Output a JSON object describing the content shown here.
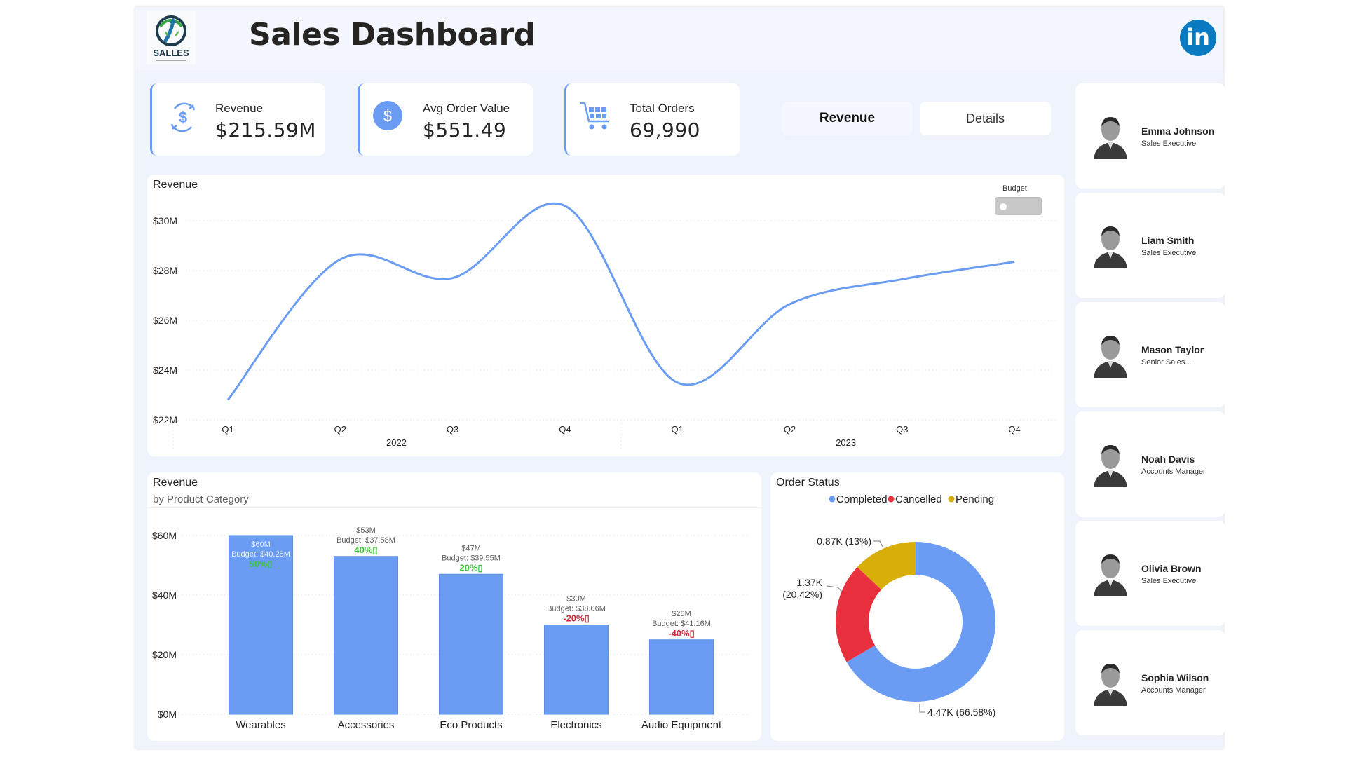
{
  "header": {
    "logo_text": "SALLES",
    "title": "Sales Dashboard",
    "linkedin_label": "in"
  },
  "kpis": [
    {
      "label": "Revenue",
      "value": "$215.59M",
      "icon": "revenue-cycle-icon"
    },
    {
      "label": "Avg Order Value",
      "value": "$551.49",
      "icon": "dollar-circle-icon"
    },
    {
      "label": "Total Orders",
      "value": "69,990",
      "icon": "shopping-cart-icon"
    }
  ],
  "tabs": {
    "revenue": "Revenue",
    "details": "Details"
  },
  "budget_toggle": {
    "label": "Budget",
    "on": false
  },
  "colors": {
    "accent": "#6a9cf4",
    "completed": "#6a9cf4",
    "cancelled": "#e8303f",
    "pending": "#d8ae08",
    "positive": "#3fc43a",
    "negative": "#d4293a",
    "linkedin": "#0a7bc1"
  },
  "chart_data": [
    {
      "type": "line",
      "title": "Revenue",
      "x": [
        "Q1",
        "Q2",
        "Q3",
        "Q4",
        "Q1",
        "Q2",
        "Q3",
        "Q4"
      ],
      "x_groups": [
        {
          "label": "2022",
          "span": [
            0,
            3
          ]
        },
        {
          "label": "2023",
          "span": [
            4,
            7
          ]
        }
      ],
      "series": [
        {
          "name": "Revenue",
          "values": [
            22.8,
            28.45,
            27.7,
            30.6,
            23.5,
            26.65,
            27.65,
            28.35
          ]
        }
      ],
      "yticks": [
        "$22M",
        "$24M",
        "$26M",
        "$28M",
        "$30M"
      ],
      "ylim": [
        22,
        30
      ],
      "unit": "$M",
      "grid": true
    },
    {
      "type": "bar",
      "title": "Revenue",
      "subtitle": "by Product Category",
      "categories": [
        "Wearables",
        "Accessories",
        "Eco Products",
        "Electronics",
        "Audio Equipment"
      ],
      "values": [
        60,
        53,
        47,
        30,
        25
      ],
      "labels": [
        {
          "value": "$60M",
          "budget": "Budget: $40.25M",
          "delta": "50%▯",
          "positive": true
        },
        {
          "value": "$53M",
          "budget": "Budget: $37.58M",
          "delta": "40%▯",
          "positive": true
        },
        {
          "value": "$47M",
          "budget": "Budget: $39.55M",
          "delta": "20%▯",
          "positive": true
        },
        {
          "value": "$30M",
          "budget": "Budget: $38.06M",
          "delta": "-20%▯",
          "positive": false
        },
        {
          "value": "$25M",
          "budget": "Budget: $41.16M",
          "delta": "-40%▯",
          "positive": false
        }
      ],
      "yticks": [
        "$0M",
        "$20M",
        "$40M",
        "$60M"
      ],
      "ylim": [
        0,
        60
      ],
      "unit": "$M",
      "grid": true
    },
    {
      "type": "pie",
      "title": "Order Status",
      "donut": true,
      "legend": [
        "Completed",
        "Cancelled",
        "Pending"
      ],
      "legend_position": "top",
      "slices": [
        {
          "name": "Completed",
          "value": 4.47,
          "percent": 66.58,
          "label": "4.47K (66.58%)"
        },
        {
          "name": "Cancelled",
          "value": 1.37,
          "percent": 20.42,
          "label_line1": "1.37K",
          "label_line2": "(20.42%)"
        },
        {
          "name": "Pending",
          "value": 0.87,
          "percent": 13,
          "label": "0.87K (13%)"
        }
      ]
    }
  ],
  "employees": [
    {
      "name": "Emma Johnson",
      "role": "Sales Executive"
    },
    {
      "name": "Liam Smith",
      "role": "Sales Executive"
    },
    {
      "name": "Mason Taylor",
      "role": "Senior Sales..."
    },
    {
      "name": "Noah Davis",
      "role": "Accounts Manager"
    },
    {
      "name": "Olivia Brown",
      "role": "Sales Executive"
    },
    {
      "name": "Sophia Wilson",
      "role": "Accounts Manager"
    }
  ]
}
